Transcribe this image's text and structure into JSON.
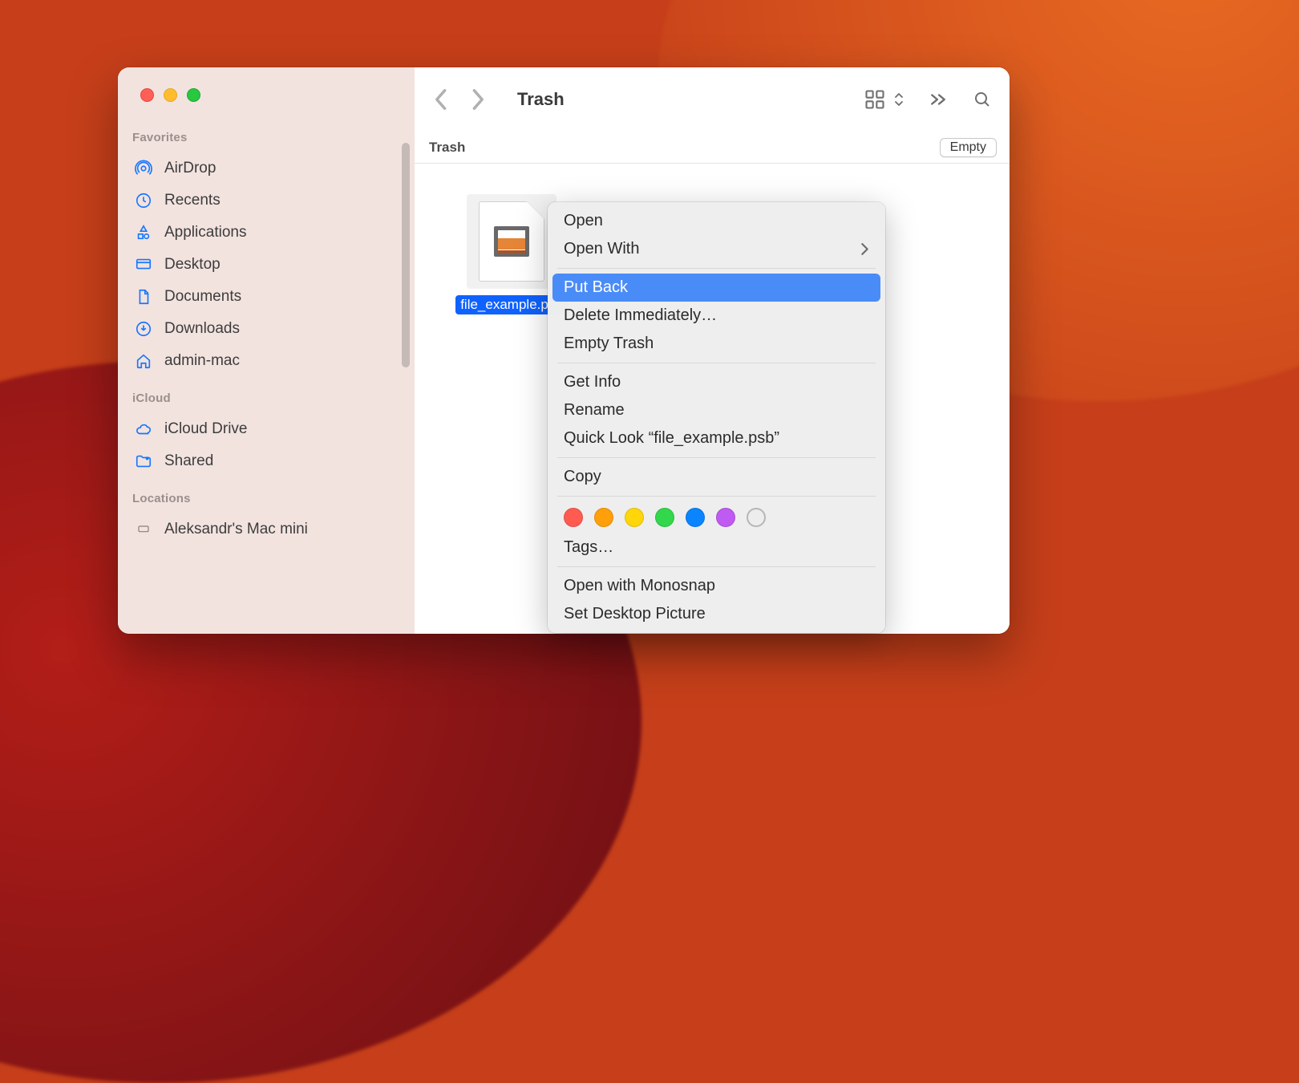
{
  "window": {
    "title": "Trash",
    "header_title": "Trash",
    "empty_button": "Empty"
  },
  "sidebar": {
    "sections": {
      "favorites": "Favorites",
      "icloud": "iCloud",
      "locations": "Locations"
    },
    "items": {
      "airdrop": "AirDrop",
      "recents": "Recents",
      "applications": "Applications",
      "desktop": "Desktop",
      "documents": "Documents",
      "downloads": "Downloads",
      "home": "admin-mac",
      "icloud_drive": "iCloud Drive",
      "shared": "Shared",
      "device": "Aleksandr's Mac mini"
    }
  },
  "file": {
    "name": "file_example.psb"
  },
  "context_menu": {
    "open": "Open",
    "open_with": "Open With",
    "put_back": "Put Back",
    "delete_immediately": "Delete Immediately…",
    "empty_trash": "Empty Trash",
    "get_info": "Get Info",
    "rename": "Rename",
    "quick_look": "Quick Look “file_example.psb”",
    "copy": "Copy",
    "tags": "Tags…",
    "open_with_monosnap": "Open with Monosnap",
    "set_desktop_picture": "Set Desktop Picture",
    "highlighted": "put_back",
    "tag_colors": [
      "#ff5b51",
      "#ff9f0a",
      "#ffd60a",
      "#32d74b",
      "#0a84ff",
      "#bf5af2"
    ]
  }
}
